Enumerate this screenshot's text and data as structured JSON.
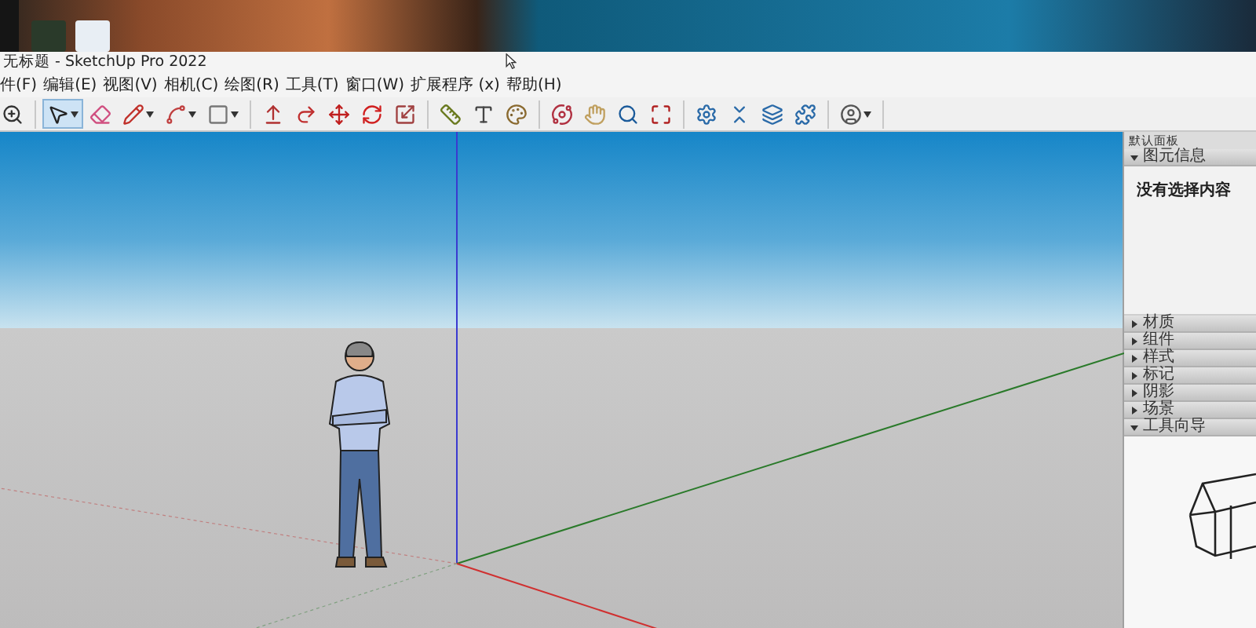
{
  "window": {
    "title": "无标题 - SketchUp Pro 2022"
  },
  "menu": [
    "件(F)",
    "编辑(E)",
    "视图(V)",
    "相机(C)",
    "绘图(R)",
    "工具(T)",
    "窗口(W)",
    "扩展程序 (x)",
    "帮助(H)"
  ],
  "toolbar": {
    "groups": [
      {
        "tools": [
          {
            "selected": false,
            "dropdown": false
          }
        ]
      },
      {
        "tools": [
          {
            "selected": true,
            "dropdown": true
          },
          {
            "selected": false,
            "dropdown": false
          },
          {
            "selected": false,
            "dropdown": true
          },
          {
            "selected": false,
            "dropdown": true
          },
          {
            "selected": false,
            "dropdown": true
          }
        ]
      },
      {
        "tools": [
          {
            "selected": false,
            "dropdown": false
          },
          {
            "selected": false,
            "dropdown": false
          },
          {
            "selected": false,
            "dropdown": false
          },
          {
            "selected": false,
            "dropdown": false
          },
          {
            "selected": false,
            "dropdown": false
          }
        ]
      },
      {
        "tools": [
          {
            "selected": false,
            "dropdown": false
          },
          {
            "selected": false,
            "dropdown": false
          },
          {
            "selected": false,
            "dropdown": false
          }
        ]
      },
      {
        "tools": [
          {
            "selected": false,
            "dropdown": false
          },
          {
            "selected": false,
            "dropdown": false
          },
          {
            "selected": false,
            "dropdown": false
          },
          {
            "selected": false,
            "dropdown": false
          }
        ]
      },
      {
        "tools": [
          {
            "selected": false,
            "dropdown": false
          },
          {
            "selected": false,
            "dropdown": false
          },
          {
            "selected": false,
            "dropdown": false
          },
          {
            "selected": false,
            "dropdown": false
          }
        ]
      },
      {
        "tools": [
          {
            "selected": false,
            "dropdown": true
          }
        ]
      }
    ]
  },
  "panel": {
    "title": "默认面板",
    "sections": [
      {
        "label": "图元信息",
        "expanded": true,
        "kind": "entity",
        "content": "没有选择内容"
      },
      {
        "label": "材质",
        "expanded": false
      },
      {
        "label": "组件",
        "expanded": false
      },
      {
        "label": "样式",
        "expanded": false
      },
      {
        "label": "标记",
        "expanded": false
      },
      {
        "label": "阴影",
        "expanded": false
      },
      {
        "label": "场景",
        "expanded": false
      },
      {
        "label": "工具向导",
        "expanded": true,
        "kind": "guide"
      }
    ]
  }
}
